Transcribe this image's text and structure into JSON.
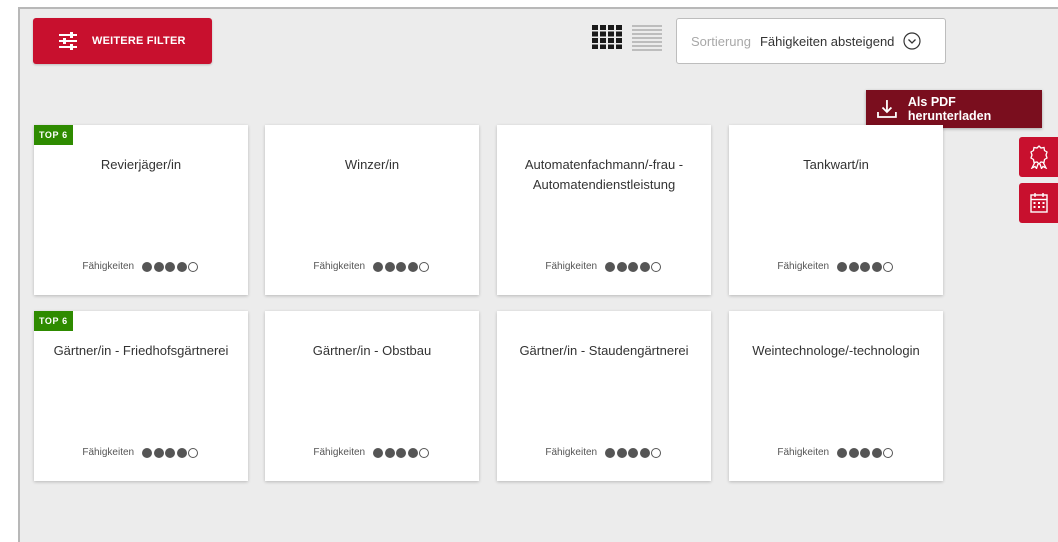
{
  "toolbar": {
    "filter_label": "WEITERE FILTER",
    "sort_label": "Sortierung",
    "sort_value": "Fähigkeiten absteigend",
    "pdf_label": "Als PDF herunterladen",
    "accent_color": "#c8102e",
    "pdf_color": "#7a0e1e",
    "icons": {
      "filter": "sliders-icon",
      "grid_view": "grid-view-icon",
      "list_view": "list-view-icon",
      "sort": "chevron-down-circle-icon",
      "pdf": "download-icon",
      "side_1": "award-ribbon-icon",
      "side_2": "calendar-icon"
    }
  },
  "cards": [
    {
      "badge": "TOP 6",
      "title": "Revierjäger/in",
      "skills_label": "Fähigkeiten",
      "rating": 4,
      "rating_max": 5
    },
    {
      "badge": "",
      "title": "Winzer/in",
      "skills_label": "Fähigkeiten",
      "rating": 4,
      "rating_max": 5
    },
    {
      "badge": "",
      "title": "Automatenfachmann/-frau - Automatendienstleistung",
      "skills_label": "Fähigkeiten",
      "rating": 4,
      "rating_max": 5
    },
    {
      "badge": "",
      "title": "Tankwart/in",
      "skills_label": "Fähigkeiten",
      "rating": 4,
      "rating_max": 5
    },
    {
      "badge": "TOP 6",
      "title": "Gärtner/in - Friedhofsgärtnerei",
      "skills_label": "Fähigkeiten",
      "rating": 4,
      "rating_max": 5
    },
    {
      "badge": "",
      "title": "Gärtner/in - Obstbau",
      "skills_label": "Fähigkeiten",
      "rating": 4,
      "rating_max": 5
    },
    {
      "badge": "",
      "title": "Gärtner/in - Staudengärtnerei",
      "skills_label": "Fähigkeiten",
      "rating": 4,
      "rating_max": 5
    },
    {
      "badge": "",
      "title": "Weintechnologe/-technologin",
      "skills_label": "Fähigkeiten",
      "rating": 4,
      "rating_max": 5
    }
  ],
  "badge_color": "#2e8b00"
}
